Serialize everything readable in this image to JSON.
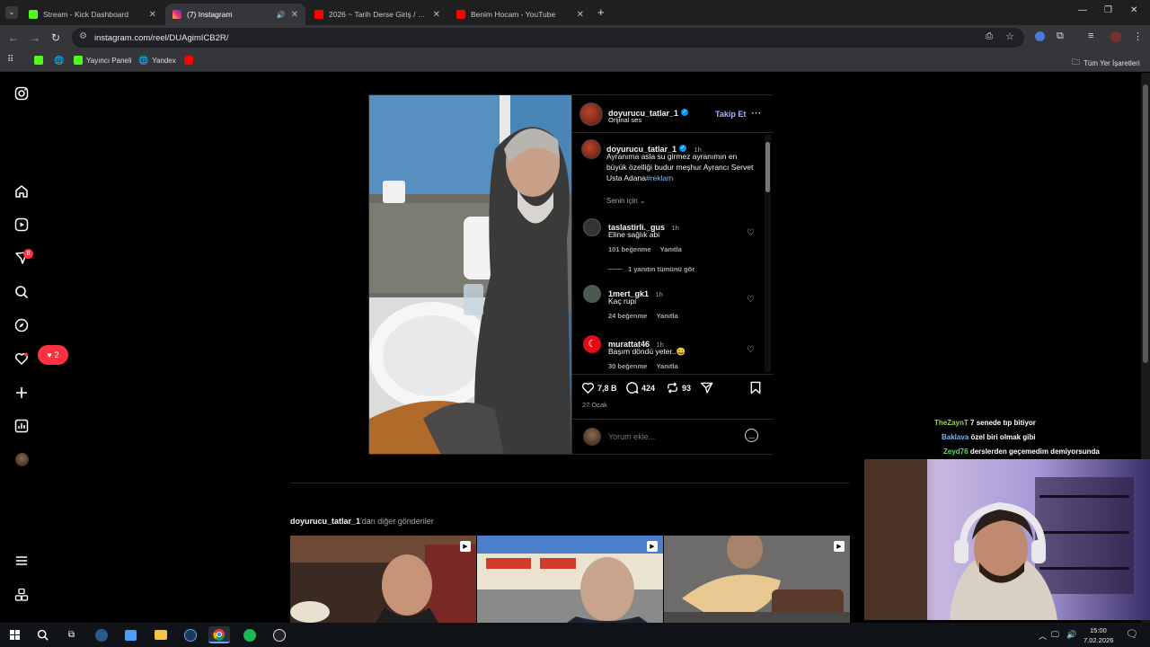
{
  "tabs": [
    {
      "label": "Stream - Kick Dashboard",
      "icon": "kick-icon",
      "color": "#53fc18"
    },
    {
      "label": "(7) Instagram",
      "icon": "instagram-icon",
      "color": "#e1306c"
    },
    {
      "label": "2026 ~ Tarih Derse Giriş / Mehm",
      "icon": "youtube-icon",
      "color": "#ff0000"
    },
    {
      "label": "Benim Hocam - YouTube",
      "icon": "youtube-icon",
      "color": "#ff0000"
    }
  ],
  "address": {
    "url": "instagram.com/reel/DUAgimICB2R/"
  },
  "bookmarks": [
    {
      "label": "Yayıncı Paneli"
    },
    {
      "label": "Yandex"
    }
  ],
  "bookmarks_all": "Tüm Yer İşaretleri",
  "sidebar": {
    "notif_count": "8",
    "like_count": "2"
  },
  "reel": {
    "author": "doyurucu_tatlar_1",
    "audio": "Orijinal ses",
    "follow_label": "Takip Et",
    "caption_author": "doyurucu_tatlar_1",
    "caption_time": "1h",
    "caption_text": "Ayranıma asla su girmez ayranımın en büyük özelliği budur meşhur Ayrancı Servet Usta Adana",
    "caption_hashtag": "#reklam",
    "sort_label": "Senin için",
    "comments": [
      {
        "user": "taslastirli._gus",
        "time": "1h",
        "text": "Eline sağlık abi",
        "likes": "101 beğenme",
        "reply": "Yanıtla"
      },
      {
        "user": "1mert_gk1",
        "time": "1h",
        "text": "Kaç rupi",
        "likes": "24 beğenme",
        "reply": "Yanıtla"
      },
      {
        "user": "murattat46",
        "time": "1h",
        "text": "Başım döndü yeter..😀",
        "likes": "30 beğenme",
        "reply": "Yanıtla"
      }
    ],
    "view_replies": "1 yanıtın tümünü gör",
    "like_count": "7,8 B",
    "comment_count": "424",
    "repost_count": "93",
    "date": "27 Ocak",
    "comment_placeholder": "Yorum ekle..."
  },
  "more_posts": {
    "author": "doyurucu_tatlar_1",
    "suffix": "'dan diğer gönderiler"
  },
  "chat": [
    {
      "user": "TheZaynT",
      "color": "#9ad94a",
      "text": "7 senede tıp bitiyor"
    },
    {
      "user": "Baklava",
      "color": "#6fb8ff",
      "text": "özel biri olmak gibi"
    },
    {
      "user": "Zeyd76",
      "color": "#5ee06a",
      "text": "derslerden geçemedim demiyorsunda"
    }
  ],
  "taskbar": {
    "time": "15:00",
    "date": "7.02.2026"
  }
}
